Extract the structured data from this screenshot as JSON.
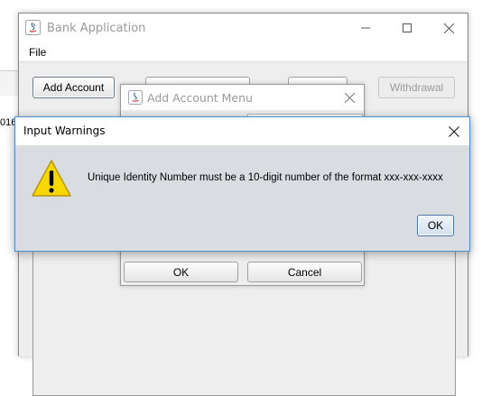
{
  "background": {
    "fragment_text": "016-"
  },
  "main_window": {
    "title": "Bank Application",
    "menu": [
      "File"
    ],
    "toolbar": {
      "add_account": "Add Account",
      "withdrawal": "Withdrawal"
    }
  },
  "add_account_dialog": {
    "title": "Add Account Menu",
    "ok_label": "OK",
    "cancel_label": "Cancel"
  },
  "warning_dialog": {
    "title": "Input Warnings",
    "message": "Unique Identity Number must be a 10-digit number of the format xxx-xxx-xxxx",
    "ok_label": "OK",
    "icon": "warning-icon"
  },
  "colors": {
    "dialog_bg": "#d9dce1",
    "window_bg": "#eeeeee",
    "warning_yellow": "#f8d800",
    "focus_border": "#4d8fd0"
  }
}
